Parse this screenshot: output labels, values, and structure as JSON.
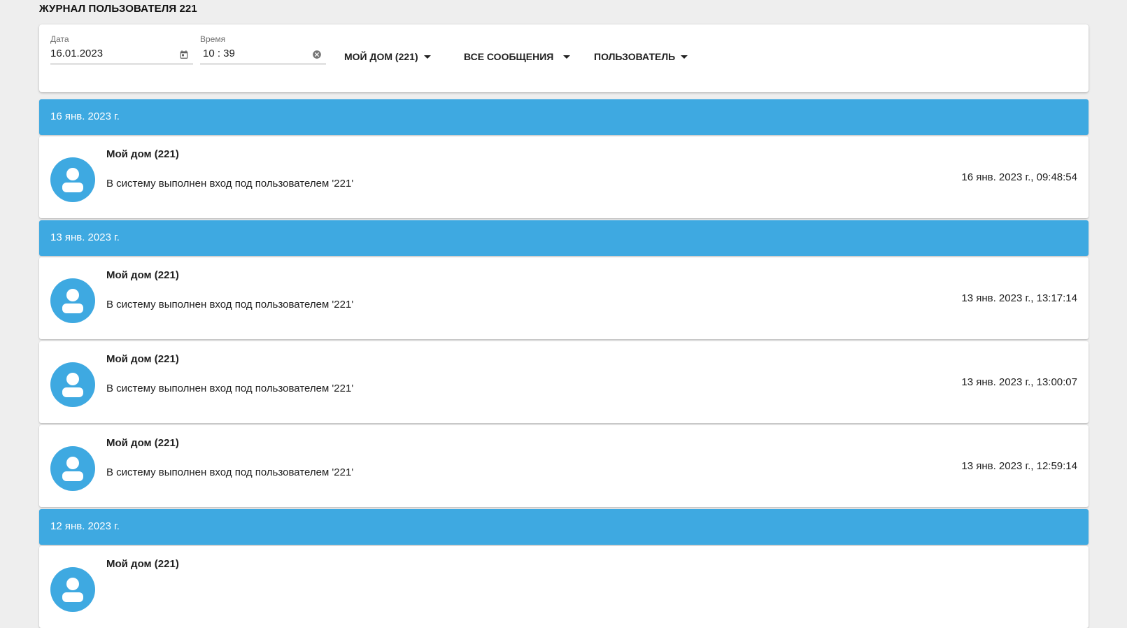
{
  "page": {
    "title": "ЖУРНАЛ ПОЛЬЗОВАТЕЛЯ 221"
  },
  "filters": {
    "date_label": "Дата",
    "date_value": "16.01.2023",
    "time_label": "Время",
    "time_value": "10 : 39",
    "home_dropdown": "МОЙ ДОМ (221)",
    "messages_dropdown": "ВСЕ СООБЩЕНИЯ",
    "user_dropdown": "ПОЛЬЗОВАТЕЛЬ"
  },
  "icons": {
    "date": "calendar-icon",
    "time_clear": "clear-circle-icon",
    "avatar": "person-icon",
    "dropdown": "caret-down-icon"
  },
  "colors": {
    "accent": "#3ea9e1",
    "background": "#eeeeee",
    "card": "#ffffff"
  },
  "log": [
    {
      "date": "16 янв. 2023 г.",
      "entries": [
        {
          "title": "Мой дом (221)",
          "message": "В систему выполнен вход под пользователем '221'",
          "time": "16 янв. 2023 г., 09:48:54"
        }
      ]
    },
    {
      "date": "13 янв. 2023 г.",
      "entries": [
        {
          "title": "Мой дом (221)",
          "message": "В систему выполнен вход под пользователем '221'",
          "time": "13 янв. 2023 г., 13:17:14"
        },
        {
          "title": "Мой дом (221)",
          "message": "В систему выполнен вход под пользователем '221'",
          "time": "13 янв. 2023 г., 13:00:07"
        },
        {
          "title": "Мой дом (221)",
          "message": "В систему выполнен вход под пользователем '221'",
          "time": "13 янв. 2023 г., 12:59:14"
        }
      ]
    },
    {
      "date": "12 янв. 2023 г.",
      "entries": [
        {
          "title": "Мой дом (221)"
        }
      ]
    }
  ]
}
